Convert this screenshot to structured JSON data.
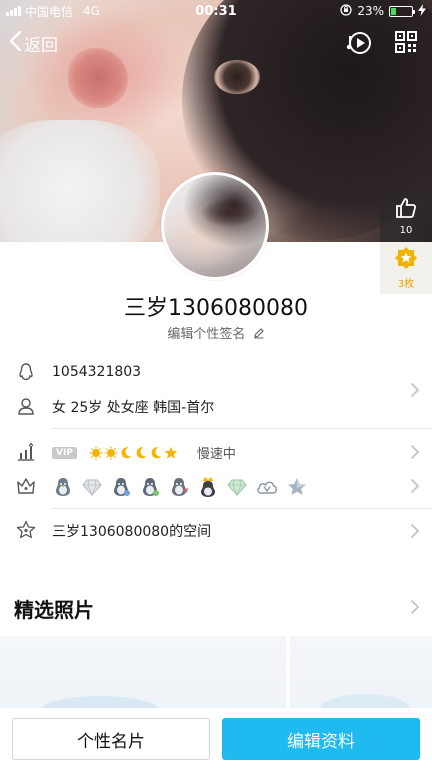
{
  "status_bar": {
    "carrier": "中国电信",
    "network": "4G",
    "time": "00:31",
    "battery_percent": "23%",
    "battery_level": 0.23
  },
  "nav": {
    "back_label": "返回",
    "icons": [
      "music-play-icon",
      "qr-code-icon"
    ]
  },
  "side_actions": {
    "likes_count": "10",
    "star_label": "3枚"
  },
  "profile": {
    "nickname": "三岁1306080080",
    "signature_prompt": "编辑个性签名"
  },
  "info": {
    "qq_number": "1054321803",
    "details": "女  25岁  处女座  韩国-首尔",
    "vip_label": "VIP",
    "speed_label": "慢速中",
    "space_label": "三岁1306080080的空间"
  },
  "sections": {
    "featured_photos": "精选照片"
  },
  "bottom": {
    "card_button": "个性名片",
    "edit_button": "编辑资料"
  },
  "colors": {
    "accent": "#1ebaf0",
    "star": "#e8a400"
  }
}
